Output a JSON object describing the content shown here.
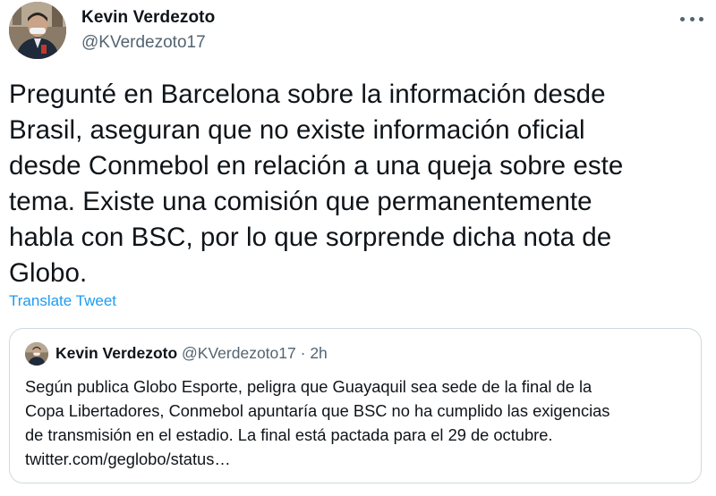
{
  "author": {
    "name": "Kevin Verdezoto",
    "handle": "@KVerdezoto17"
  },
  "more_icon": "more-horizontal-icon",
  "tweet_lines": [
    "Pregunté en Barcelona sobre la información desde",
    "Brasil, aseguran que no existe información oficial",
    "desde Conmebol en relación a una queja sobre este",
    "tema. Existe una comisión que permanentemente",
    "habla con BSC, por lo que sorprende dicha nota de",
    "Globo."
  ],
  "translate_label": "Translate Tweet",
  "colors": {
    "link": "#1d9bf0",
    "secondary_text": "#536471",
    "primary_text": "#0f1419",
    "border": "#cfd9de"
  },
  "quoted_tweet": {
    "name": "Kevin Verdezoto",
    "handle": "@KVerdezoto17",
    "separator": "·",
    "time": "2h",
    "text_lines": [
      "Según publica Globo Esporte, peligra que Guayaquil sea sede de la final de la",
      "Copa Libertadores, Conmebol apuntaría que BSC no ha cumplido las exigencias",
      "de transmisión en el estadio. La final está pactada para el 29 de octubre.",
      "twitter.com/geglobo/status…"
    ]
  }
}
